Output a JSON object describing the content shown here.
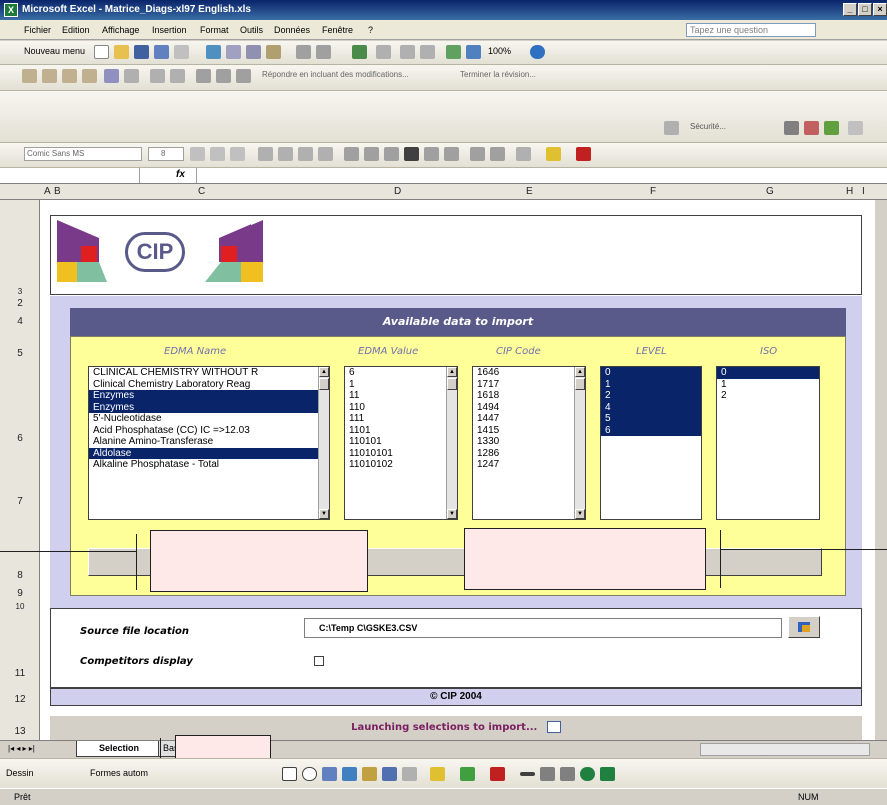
{
  "window": {
    "title": "Microsoft Excel - Matrice_Diags-xl97 English.xls"
  },
  "menu": {
    "items": [
      "Fichier",
      "Edition",
      "Affichage",
      "Insertion",
      "Format",
      "Outils",
      "Données",
      "Fenêtre",
      "?"
    ],
    "ask_placeholder": "Tapez une question"
  },
  "toolbar1": {
    "new_menu": "Nouveau menu",
    "zoom": "100%"
  },
  "toolbar2": {
    "reply_text": "Répondre en incluant des modifications...",
    "end_review": "Terminer la révision..."
  },
  "toolbar3": {
    "security": "Sécurité..."
  },
  "toolbar4": {
    "font": "Comic Sans MS",
    "size": "8"
  },
  "formula_bar": {
    "fx": "fx"
  },
  "columns": [
    "A",
    "B",
    "C",
    "D",
    "E",
    "F",
    "G",
    "H",
    "I"
  ],
  "rows": [
    "2",
    "3",
    "4",
    "5",
    "6",
    "7",
    "8",
    "9",
    "10",
    "11",
    "12",
    "13"
  ],
  "logo": {
    "text": "CIP"
  },
  "panel": {
    "title": "Available data to import",
    "headers": {
      "edma_name": "EDMA Name",
      "edma_value": "EDMA Value",
      "cip_code": "CIP Code",
      "level": "LEVEL",
      "iso": "ISO"
    },
    "edma_names": [
      {
        "text": "CLINICAL CHEMISTRY WITHOUT R",
        "sel": false
      },
      {
        "text": "Clinical Chemistry Laboratory Reag",
        "sel": false
      },
      {
        "text": "Enzymes",
        "sel": true
      },
      {
        "text": "Enzymes",
        "sel": true
      },
      {
        "text": "5'-Nucleotidase",
        "sel": false
      },
      {
        "text": "Acid Phosphatase (CC) IC =>12.03",
        "sel": false
      },
      {
        "text": "Alanine Amino-Transferase",
        "sel": false
      },
      {
        "text": "Aldolase",
        "sel": true
      },
      {
        "text": "Alkaline Phosphatase - Total",
        "sel": false
      }
    ],
    "edma_values": [
      "6",
      "1",
      "11",
      "110",
      "111",
      "1101",
      "110101",
      "11010101",
      "11010102"
    ],
    "cip_codes": [
      "1646",
      "1717",
      "1618",
      "1494",
      "1447",
      "1415",
      "1330",
      "1286",
      "1247"
    ],
    "levels": [
      {
        "text": "0",
        "sel": true
      },
      {
        "text": "1",
        "sel": true
      },
      {
        "text": "2",
        "sel": true
      },
      {
        "text": "4",
        "sel": true
      },
      {
        "text": "5",
        "sel": true
      },
      {
        "text": "6",
        "sel": true
      }
    ],
    "iso": [
      {
        "text": "0",
        "sel": true
      },
      {
        "text": "1",
        "sel": false
      },
      {
        "text": "2",
        "sel": false
      }
    ]
  },
  "source": {
    "label": "Source file location",
    "path": "C:\\Temp C\\GSKE3.CSV"
  },
  "competitors": {
    "label": "Competitors display"
  },
  "footer": {
    "copyright": "© CIP 2004"
  },
  "launch": {
    "text": "Launching selections to import..."
  },
  "tabs": {
    "active": "Selection",
    "next": "Bas"
  },
  "drawbar": {
    "draw": "Dessin",
    "autoshapes": "Formes autom"
  },
  "status": {
    "left": "Prêt",
    "right": "NUM"
  }
}
